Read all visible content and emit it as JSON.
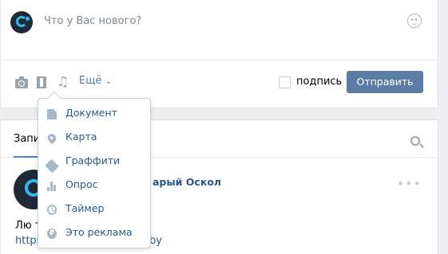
{
  "composer": {
    "placeholder": "Что у Вас нового?",
    "more_label": "Ещё",
    "signature_label": "подпись",
    "send_label": "Отправить"
  },
  "dropdown": {
    "items": [
      {
        "label": "Документ",
        "icon": "document-icon"
      },
      {
        "label": "Карта",
        "icon": "map-pin-icon"
      },
      {
        "label": "Граффити",
        "icon": "brush-icon"
      },
      {
        "label": "Опрос",
        "icon": "poll-icon"
      },
      {
        "label": "Таймер",
        "icon": "timer-icon"
      },
      {
        "label": "Это реклама",
        "icon": "ruble-icon"
      }
    ]
  },
  "feed": {
    "tab_active": "Запи",
    "post": {
      "author_visible": "арый Оскол",
      "text_visible": "Лю т",
      "link_visible_start": "https",
      "link_visible_end": "by"
    }
  },
  "colors": {
    "accent": "#5b7ca4",
    "link": "#2a5885",
    "icon_gray": "#99a3ae",
    "background": "#edeef0"
  }
}
